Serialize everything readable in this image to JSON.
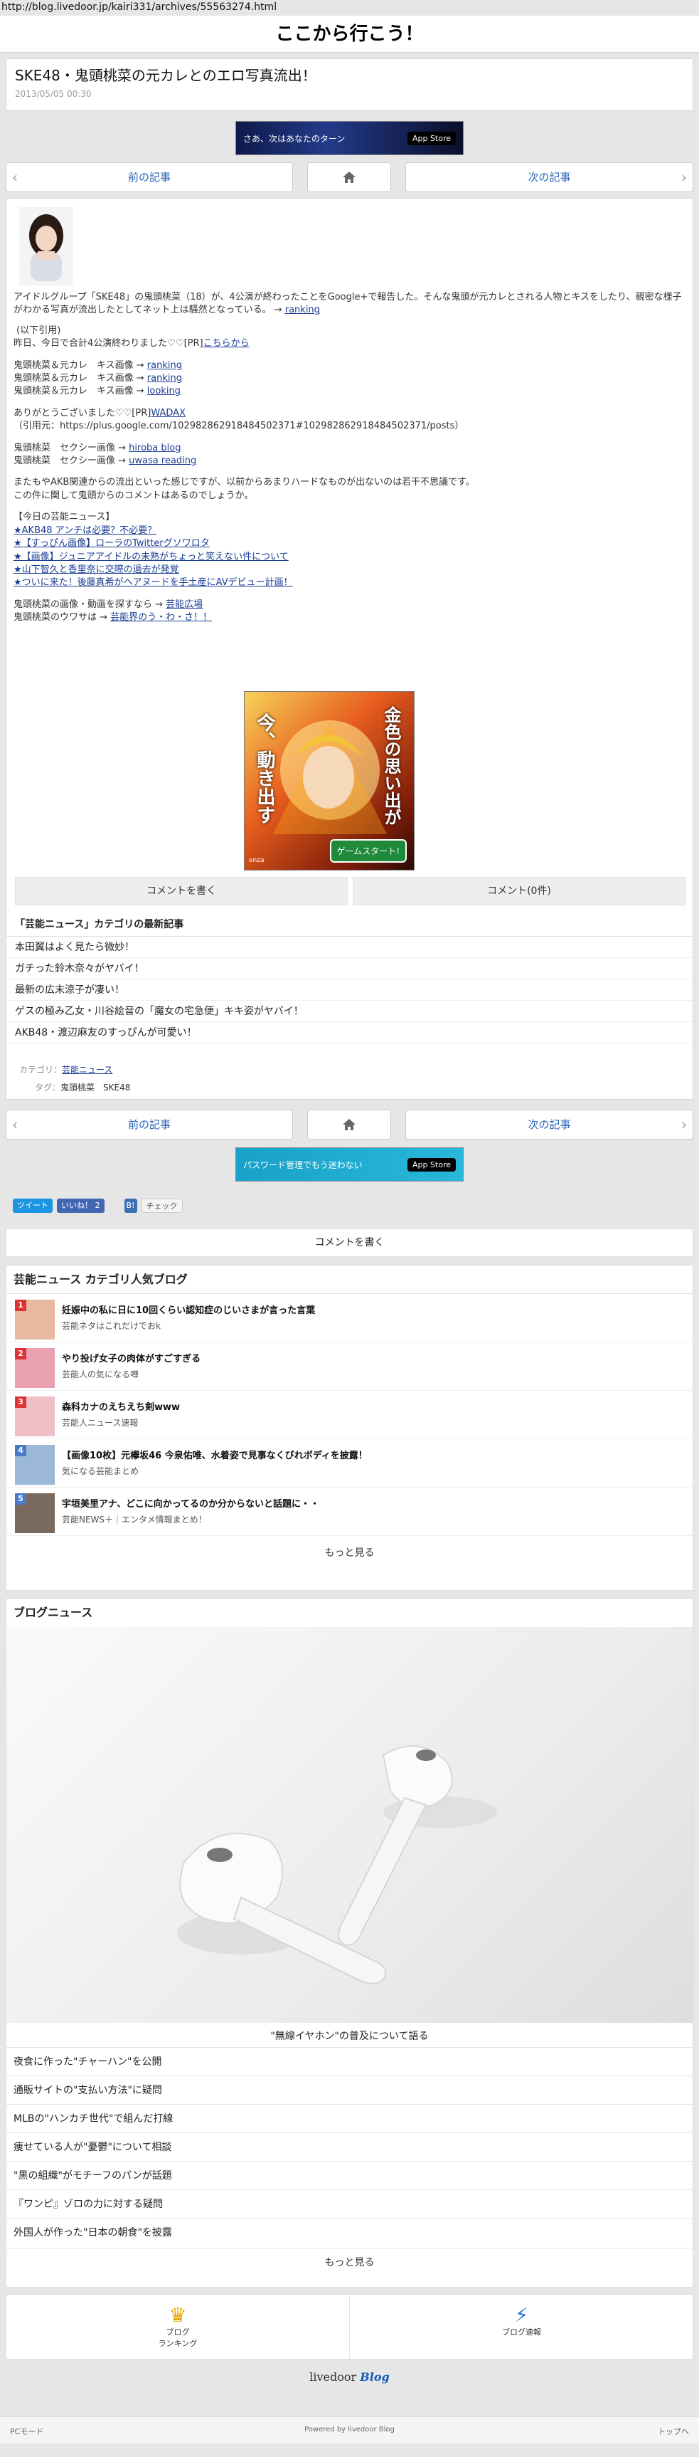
{
  "browser": {
    "url": "http://blog.livedoor.jp/kairi331/archives/55563274.html"
  },
  "site": {
    "title": "ここから行こう！"
  },
  "article": {
    "title": "SKE48・鬼頭桃菜の元カレとのエロ写真流出！",
    "date": "2013/05/05 00:30",
    "intro": "アイドルグループ「SKE48」の鬼頭桃菜（18）が、4公演が終わったことをGoogle+で報告した。そんな鬼頭が元カレとされる人物とキスをしたり、親密な様子がわかる写真が流出したとしてネット上は騒然となっている。 → ",
    "intro_link": "ranking",
    "quote_head": " (以下引用)",
    "quote_line": "昨日、今日で合計4公演終わりました♡♡[PR]",
    "quote_link": "こちらから",
    "kiss_lines": [
      {
        "text": "鬼頭桃菜＆元カレ　キス画像 → ",
        "link": "ranking"
      },
      {
        "text": "鬼頭桃菜＆元カレ　キス画像 → ",
        "link": "ranking"
      },
      {
        "text": "鬼頭桃菜＆元カレ　キス画像 → ",
        "link": "looking"
      }
    ],
    "thanks_line": "ありがとうございました♡♡[PR]",
    "thanks_link": "WADAX",
    "cite": "（引用元：https://plus.google.com/102982862918484502371#102982862918484502371/posts）",
    "sexy_lines": [
      {
        "text": "鬼頭桃菜　セクシー画像 → ",
        "link": "hiroba blog"
      },
      {
        "text": "鬼頭桃菜　セクシー画像 → ",
        "link": "uwasa reading"
      }
    ],
    "outro": "またもやAKB関連からの流出といった感じですが、以前からあまりハードなものが出ないのは若干不思議です。\nこの件に関して鬼頭からのコメントはあるのでしょうか。",
    "today_head": "【今日の芸能ニュース】",
    "today_links": [
      "★AKB48 アンチは必要？不必要？",
      "★【すっぴん画像】ローラのTwitterグソワロタ",
      "★【画像】ジュニアアイドルの未熟がちょっと笑えない件について",
      "★山下智久と香里奈に交際の過去が発覚",
      "★ついに来た！後藤真希がヘアヌードを手土産にAVデビュー計画！"
    ],
    "foot_lines": [
      {
        "text": "鬼頭桃菜の画像・動画を探すなら → ",
        "link": "芸能広場"
      },
      {
        "text": "鬼頭桃菜のウワサは → ",
        "link": "芸能界のう・わ・さ！！"
      }
    ],
    "banner_text1": "金色の思い出が",
    "banner_text2": "今、動き出す",
    "banner_btn": "ゲームスタート!",
    "banner_brand": "enza",
    "comment_write": "コメントを書く",
    "comment_count": "コメント(0件)",
    "latest_title": "「芸能ニュース」カテゴリの最新記事",
    "latest": [
      "本田翼はよく見たら微妙！",
      "ガチった鈴木奈々がヤバイ！",
      "最新の広末涼子が凄い！",
      "ゲスの極み乙女・川谷絵音の「魔女の宅急便」キキ姿がヤバイ！",
      "AKB48・渡辺麻友のすっぴんが可愛い！"
    ],
    "category_label": "カテゴリ：",
    "category_value": "芸能ニュース",
    "tag_label": "タグ：",
    "tags": "鬼頭桃菜　SKE48"
  },
  "nav": {
    "prev": "前の記事",
    "next": "次の記事"
  },
  "ads": {
    "top_text": "さあ、次はあなたのターン",
    "top_store": "App Store",
    "mid_text": "パスワード管理でもう迷わない",
    "mid_store": "App Store"
  },
  "social": {
    "tweet": "ツイート",
    "like": "いいね！ 2",
    "check": "チェック"
  },
  "popular": {
    "title": "芸能ニュース カテゴリ人気ブログ",
    "items": [
      {
        "rank": "1",
        "title": "妊娠中の私に日に10回くらい認知症のじいさまが言った言葉",
        "source": "芸能ネタはこれだけでおk"
      },
      {
        "rank": "2",
        "title": "やり投げ女子の肉体がすごすぎる",
        "source": "芸能人の気になる噂"
      },
      {
        "rank": "3",
        "title": "森科カナのえちえち剣www",
        "source": "芸能人ニュース速報"
      },
      {
        "rank": "4",
        "title": "【画像10枚】元欅坂46 今泉佑唯、水着姿で見事なくびれボディを披露！",
        "source": "気になる芸能まとめ"
      },
      {
        "rank": "5",
        "title": "宇垣美里アナ、どこに向かってるのか分からないと話題に・・",
        "source": "芸能NEWS＋｜エンタメ情報まとめ！"
      }
    ],
    "more": "もっと見る"
  },
  "news": {
    "title": "ブログニュース",
    "caption": "\"無線イヤホン\"の普及について語る",
    "items": [
      "夜食に作った\"チャーハン\"を公開",
      "通販サイトの\"支払い方法\"に疑問",
      "MLBの\"ハンカチ世代\"で組んだ打線",
      "痩せている人が\"憂鬱\"について相談",
      "\"黒の組織\"がモチーフのパンが話題",
      "『ワンピ』ゾロの力に対する疑問",
      "外国人が作った\"日本の朝食\"を披露"
    ],
    "more": "もっと見る"
  },
  "bottom_nav": {
    "ranking": "ブログ\nランキング",
    "news": "ブログ速報"
  },
  "brand": {
    "livedoor": "livedoor",
    "blog": "Blog"
  },
  "footer": {
    "pc": "PCモード",
    "powered": "Powered by livedoor Blog",
    "top": "トップへ"
  },
  "colors": {
    "link": "#1a3c94",
    "nav_text": "#2a62b8",
    "rank_badge": "#d33333"
  }
}
